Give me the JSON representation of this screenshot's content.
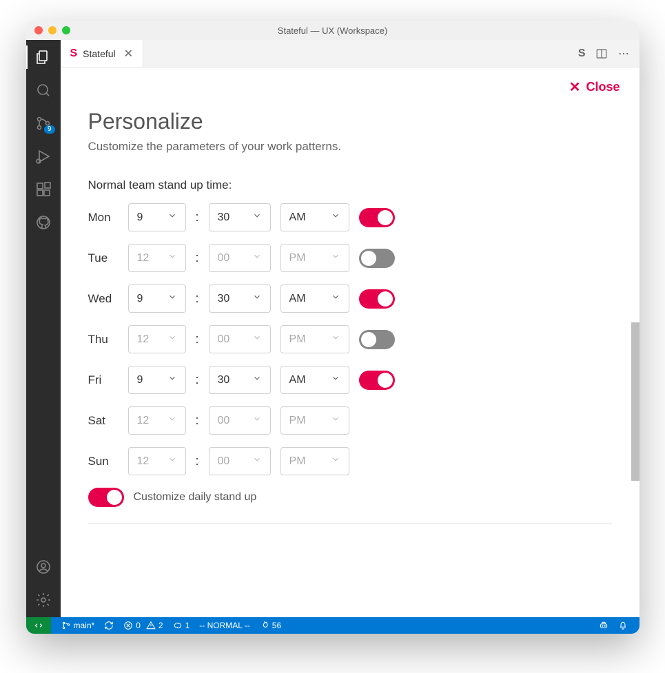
{
  "window": {
    "title": "Stateful — UX (Workspace)"
  },
  "tab": {
    "label": "Stateful"
  },
  "close": {
    "label": "Close"
  },
  "panel": {
    "heading": "Personalize",
    "subtitle": "Customize the parameters of your work patterns.",
    "section_label": "Normal team stand up time:",
    "customize_label": "Customize daily stand up",
    "customize_enabled": true
  },
  "days": [
    {
      "label": "Mon",
      "hour": "9",
      "min": "30",
      "ampm": "AM",
      "enabled": true,
      "toggle": true
    },
    {
      "label": "Tue",
      "hour": "12",
      "min": "00",
      "ampm": "PM",
      "enabled": false,
      "toggle": true
    },
    {
      "label": "Wed",
      "hour": "9",
      "min": "30",
      "ampm": "AM",
      "enabled": true,
      "toggle": true
    },
    {
      "label": "Thu",
      "hour": "12",
      "min": "00",
      "ampm": "PM",
      "enabled": false,
      "toggle": true
    },
    {
      "label": "Fri",
      "hour": "9",
      "min": "30",
      "ampm": "AM",
      "enabled": true,
      "toggle": true
    },
    {
      "label": "Sat",
      "hour": "12",
      "min": "00",
      "ampm": "PM",
      "enabled": false,
      "toggle": false
    },
    {
      "label": "Sun",
      "hour": "12",
      "min": "00",
      "ampm": "PM",
      "enabled": false,
      "toggle": false
    }
  ],
  "activity": {
    "scm_badge": "9"
  },
  "status": {
    "branch": "main*",
    "errors": "0",
    "warnings": "2",
    "ports": "1",
    "mode": "-- NORMAL --",
    "flame": "56"
  }
}
